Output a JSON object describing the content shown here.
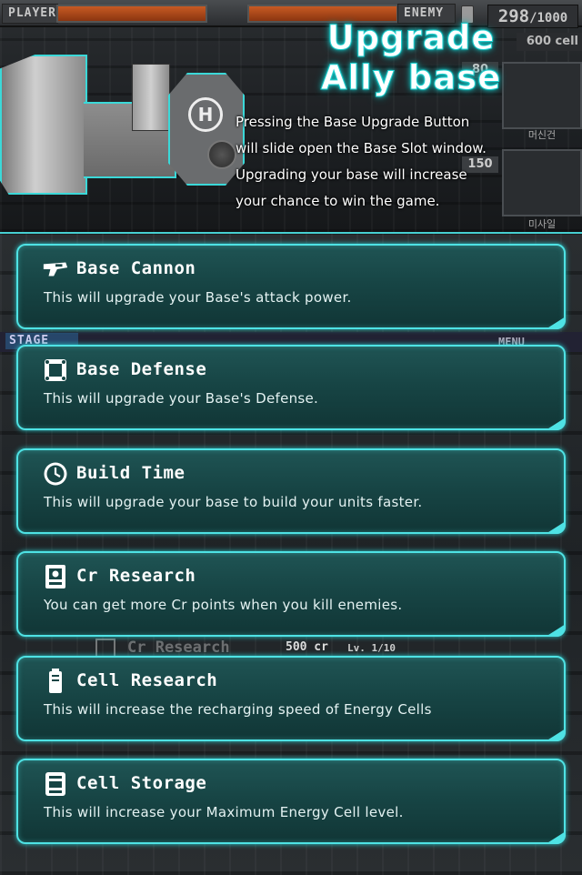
{
  "hud": {
    "player_label": "PLAYER",
    "enemy_label": "ENEMY",
    "cell_count": "298",
    "cell_max": "/1000",
    "cell_cost": "600 cell",
    "side_numbers": [
      "80",
      "150"
    ],
    "side_labels": [
      "머신건",
      "미사일"
    ]
  },
  "heading": {
    "line1": "Upgrade",
    "line2": "Ally base"
  },
  "description": [
    "Pressing the Base Upgrade Button",
    "will slide open the Base Slot window.",
    "Upgrading your base will increase",
    "your chance to win the game."
  ],
  "background": {
    "stage_label": "STAGE",
    "menu_label": "MENU",
    "ghost_title": "Cr Research",
    "ghost_cost": "500 cr",
    "ghost_level": "Lv. 1/10"
  },
  "upgrades": [
    {
      "icon": "cannon-icon",
      "title": "Base Cannon",
      "desc": "This will upgrade your Base's attack power."
    },
    {
      "icon": "shield-block-icon",
      "title": "Base Defense",
      "desc": "This will upgrade your Base's Defense."
    },
    {
      "icon": "clock-icon",
      "title": "Build Time",
      "desc": "This will upgrade your base to build your units faster."
    },
    {
      "icon": "research-chip-icon",
      "title": "Cr Research",
      "desc": "You can get more Cr points when you kill enemies."
    },
    {
      "icon": "battery-icon",
      "title": "Cell Research",
      "desc": "This will increase the recharging speed of Energy Cells"
    },
    {
      "icon": "cell-storage-icon",
      "title": "Cell Storage",
      "desc": "This will increase your Maximum Energy Cell level."
    }
  ],
  "colors": {
    "accent": "#4ee2e4",
    "card_bg": "#174545",
    "hp_bar": "#c85a23"
  }
}
